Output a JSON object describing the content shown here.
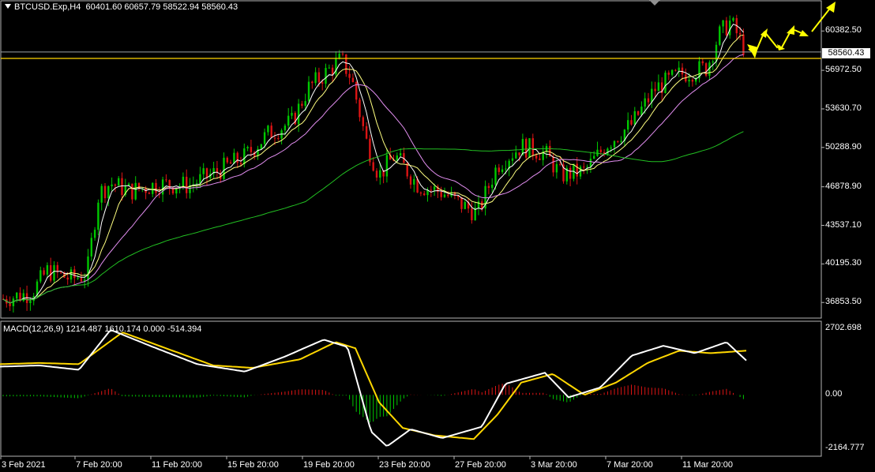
{
  "header": {
    "symbol": "BTCUSD.Exp,H4",
    "ohlc": "60401.60 60657.79 58522.94 58560.43"
  },
  "macd_header": "MACD(12,26,9) 1214.487 1610.174 0.000 -514.394",
  "current_price_label": "58560.43",
  "colors": {
    "background": "#000000",
    "bull": "#00c800",
    "bear": "#dc1414",
    "ma_fast": "#ffffff",
    "ma_mid": "#ffff80",
    "ma_slow": "#e28ef0",
    "ma_long": "#22c022",
    "macd_line": "#ffffff",
    "signal_line": "#ffd700",
    "level_line": "#ffd700",
    "forecast_arrows": "#ffff00"
  },
  "chart_data": [
    {
      "type": "candlestick",
      "title": "BTCUSD.Exp,H4",
      "ylim": [
        35500,
        63000
      ],
      "y_ticks": [
        "60382.50",
        "56972.50",
        "53630.70",
        "50288.90",
        "46878.90",
        "43537.10",
        "40195.30",
        "36853.50"
      ],
      "x_ticks": [
        "3 Feb 2021",
        "7 Feb 20:00",
        "11 Feb 20:00",
        "15 Feb 20:00",
        "19 Feb 20:00",
        "23 Feb 20:00",
        "27 Feb 20:00",
        "3 Mar 20:00",
        "7 Mar 20:00",
        "11 Mar 20:00"
      ],
      "horizontal_level": 58560.43,
      "overlays": [
        "fast MA (white)",
        "mid MA (yellow)",
        "slow MA (violet)",
        "long MA (green)"
      ],
      "close_path_approx": [
        [
          0,
          37100
        ],
        [
          40,
          37700
        ],
        [
          60,
          39600
        ],
        [
          90,
          38900
        ],
        [
          110,
          39300
        ],
        [
          125,
          46300
        ],
        [
          140,
          47200
        ],
        [
          165,
          46500
        ],
        [
          200,
          47100
        ],
        [
          240,
          47000
        ],
        [
          275,
          48200
        ],
        [
          310,
          49500
        ],
        [
          340,
          51500
        ],
        [
          370,
          52500
        ],
        [
          390,
          55400
        ],
        [
          415,
          56900
        ],
        [
          432,
          57900
        ],
        [
          445,
          56300
        ],
        [
          465,
          50500
        ],
        [
          480,
          47900
        ],
        [
          500,
          49600
        ],
        [
          530,
          47000
        ],
        [
          560,
          46400
        ],
        [
          590,
          45100
        ],
        [
          605,
          44600
        ],
        [
          630,
          48800
        ],
        [
          660,
          50400
        ],
        [
          690,
          49800
        ],
        [
          710,
          47900
        ],
        [
          740,
          48200
        ],
        [
          770,
          50700
        ],
        [
          800,
          52300
        ],
        [
          830,
          55400
        ],
        [
          860,
          56600
        ],
        [
          895,
          57200
        ],
        [
          910,
          60000
        ],
        [
          925,
          61200
        ],
        [
          945,
          58560
        ]
      ],
      "forecast": "zigzag arrows pointing up"
    },
    {
      "type": "line",
      "title": "MACD(12,26,9)",
      "series": [
        {
          "name": "MACD",
          "values_approx": [
            [
              0,
              1150
            ],
            [
              50,
              1200
            ],
            [
              100,
              1020
            ],
            [
              140,
              2650
            ],
            [
              190,
              2000
            ],
            [
              250,
              1250
            ],
            [
              310,
              950
            ],
            [
              360,
              1550
            ],
            [
              410,
              2250
            ],
            [
              440,
              1950
            ],
            [
              470,
              -1500
            ],
            [
              490,
              -2100
            ],
            [
              520,
              -1400
            ],
            [
              560,
              -1760
            ],
            [
              610,
              -1300
            ],
            [
              640,
              450
            ],
            [
              690,
              900
            ],
            [
              720,
              -100
            ],
            [
              760,
              300
            ],
            [
              800,
              1600
            ],
            [
              840,
              2000
            ],
            [
              880,
              1700
            ],
            [
              920,
              2150
            ],
            [
              945,
              1400
            ]
          ]
        },
        {
          "name": "Signal",
          "values_approx": [
            [
              0,
              1250
            ],
            [
              50,
              1300
            ],
            [
              100,
              1250
            ],
            [
              155,
              2550
            ],
            [
              210,
              1900
            ],
            [
              270,
              1200
            ],
            [
              320,
              1100
            ],
            [
              380,
              1450
            ],
            [
              425,
              2150
            ],
            [
              450,
              1900
            ],
            [
              480,
              -300
            ],
            [
              510,
              -1350
            ],
            [
              550,
              -1650
            ],
            [
              600,
              -1800
            ],
            [
              630,
              -800
            ],
            [
              660,
              500
            ],
            [
              700,
              850
            ],
            [
              740,
              0
            ],
            [
              780,
              500
            ],
            [
              820,
              1300
            ],
            [
              860,
              1800
            ],
            [
              900,
              1700
            ],
            [
              945,
              1800
            ]
          ]
        }
      ],
      "histogram_note": "red bars above zero, green bars below zero",
      "y_ticks": [
        "2702.698",
        "0.00",
        "-2164.777"
      ],
      "ylim": [
        -2500,
        3000
      ]
    }
  ]
}
